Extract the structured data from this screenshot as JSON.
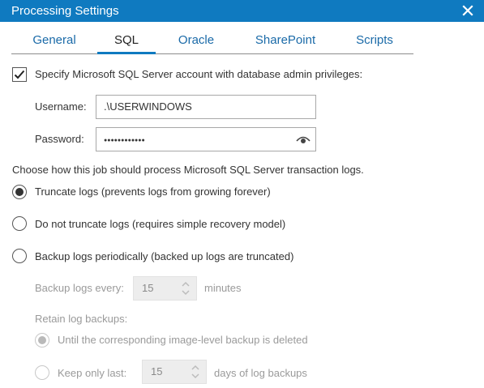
{
  "window": {
    "title": "Processing Settings"
  },
  "tabs": [
    {
      "label": "General",
      "active": false
    },
    {
      "label": "SQL",
      "active": true
    },
    {
      "label": "Oracle",
      "active": false
    },
    {
      "label": "SharePoint",
      "active": false
    },
    {
      "label": "Scripts",
      "active": false
    }
  ],
  "account": {
    "checkbox_label": "Specify Microsoft SQL Server account with database admin privileges:",
    "checked": true,
    "username_label": "Username:",
    "username_value": ".\\USERWINDOWS",
    "password_label": "Password:",
    "password_value": "●●●●●●●●●●●●"
  },
  "logs": {
    "prompt": "Choose how this job should process Microsoft SQL Server transaction logs.",
    "options": [
      {
        "label": "Truncate logs (prevents logs from growing forever)",
        "selected": true
      },
      {
        "label": "Do not truncate logs (requires simple recovery model)",
        "selected": false
      },
      {
        "label": "Backup logs periodically (backed up logs are truncated)",
        "selected": false
      }
    ],
    "backup_every_label": "Backup logs every:",
    "backup_every_value": "15",
    "backup_every_unit": "minutes",
    "retain_label": "Retain log backups:",
    "retain_options": [
      {
        "label": "Until the corresponding image-level backup is deleted",
        "selected": true
      },
      {
        "label": "Keep only last:",
        "selected": false
      }
    ],
    "keep_last_value": "15",
    "keep_last_unit": "days of log backups"
  },
  "colors": {
    "titlebar": "#0f7ac0",
    "tab_link": "#1a6aa8",
    "disabled_text": "#9a9a9a"
  },
  "icons": [
    "close-icon",
    "checkmark-icon",
    "eye-icon",
    "spin-arrows-icon"
  ]
}
